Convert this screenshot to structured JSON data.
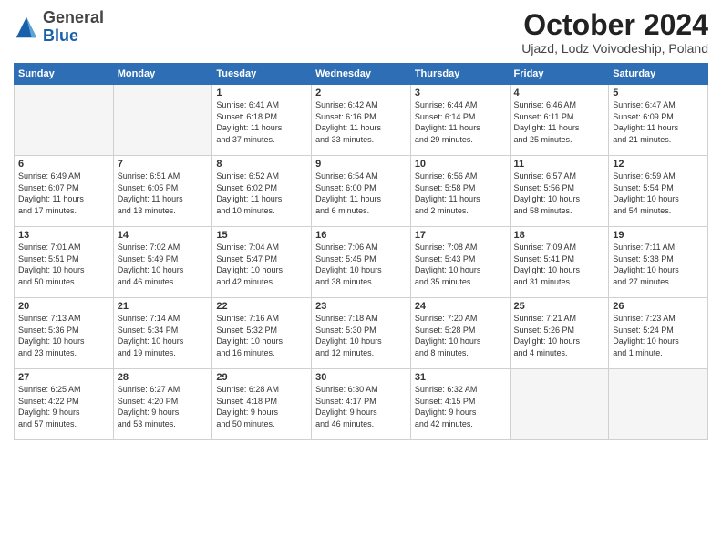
{
  "header": {
    "logo_line1": "General",
    "logo_line2": "Blue",
    "month_title": "October 2024",
    "subtitle": "Ujazd, Lodz Voivodeship, Poland"
  },
  "weekdays": [
    "Sunday",
    "Monday",
    "Tuesday",
    "Wednesday",
    "Thursday",
    "Friday",
    "Saturday"
  ],
  "weeks": [
    [
      {
        "day": "",
        "info": ""
      },
      {
        "day": "",
        "info": ""
      },
      {
        "day": "1",
        "info": "Sunrise: 6:41 AM\nSunset: 6:18 PM\nDaylight: 11 hours\nand 37 minutes."
      },
      {
        "day": "2",
        "info": "Sunrise: 6:42 AM\nSunset: 6:16 PM\nDaylight: 11 hours\nand 33 minutes."
      },
      {
        "day": "3",
        "info": "Sunrise: 6:44 AM\nSunset: 6:14 PM\nDaylight: 11 hours\nand 29 minutes."
      },
      {
        "day": "4",
        "info": "Sunrise: 6:46 AM\nSunset: 6:11 PM\nDaylight: 11 hours\nand 25 minutes."
      },
      {
        "day": "5",
        "info": "Sunrise: 6:47 AM\nSunset: 6:09 PM\nDaylight: 11 hours\nand 21 minutes."
      }
    ],
    [
      {
        "day": "6",
        "info": "Sunrise: 6:49 AM\nSunset: 6:07 PM\nDaylight: 11 hours\nand 17 minutes."
      },
      {
        "day": "7",
        "info": "Sunrise: 6:51 AM\nSunset: 6:05 PM\nDaylight: 11 hours\nand 13 minutes."
      },
      {
        "day": "8",
        "info": "Sunrise: 6:52 AM\nSunset: 6:02 PM\nDaylight: 11 hours\nand 10 minutes."
      },
      {
        "day": "9",
        "info": "Sunrise: 6:54 AM\nSunset: 6:00 PM\nDaylight: 11 hours\nand 6 minutes."
      },
      {
        "day": "10",
        "info": "Sunrise: 6:56 AM\nSunset: 5:58 PM\nDaylight: 11 hours\nand 2 minutes."
      },
      {
        "day": "11",
        "info": "Sunrise: 6:57 AM\nSunset: 5:56 PM\nDaylight: 10 hours\nand 58 minutes."
      },
      {
        "day": "12",
        "info": "Sunrise: 6:59 AM\nSunset: 5:54 PM\nDaylight: 10 hours\nand 54 minutes."
      }
    ],
    [
      {
        "day": "13",
        "info": "Sunrise: 7:01 AM\nSunset: 5:51 PM\nDaylight: 10 hours\nand 50 minutes."
      },
      {
        "day": "14",
        "info": "Sunrise: 7:02 AM\nSunset: 5:49 PM\nDaylight: 10 hours\nand 46 minutes."
      },
      {
        "day": "15",
        "info": "Sunrise: 7:04 AM\nSunset: 5:47 PM\nDaylight: 10 hours\nand 42 minutes."
      },
      {
        "day": "16",
        "info": "Sunrise: 7:06 AM\nSunset: 5:45 PM\nDaylight: 10 hours\nand 38 minutes."
      },
      {
        "day": "17",
        "info": "Sunrise: 7:08 AM\nSunset: 5:43 PM\nDaylight: 10 hours\nand 35 minutes."
      },
      {
        "day": "18",
        "info": "Sunrise: 7:09 AM\nSunset: 5:41 PM\nDaylight: 10 hours\nand 31 minutes."
      },
      {
        "day": "19",
        "info": "Sunrise: 7:11 AM\nSunset: 5:38 PM\nDaylight: 10 hours\nand 27 minutes."
      }
    ],
    [
      {
        "day": "20",
        "info": "Sunrise: 7:13 AM\nSunset: 5:36 PM\nDaylight: 10 hours\nand 23 minutes."
      },
      {
        "day": "21",
        "info": "Sunrise: 7:14 AM\nSunset: 5:34 PM\nDaylight: 10 hours\nand 19 minutes."
      },
      {
        "day": "22",
        "info": "Sunrise: 7:16 AM\nSunset: 5:32 PM\nDaylight: 10 hours\nand 16 minutes."
      },
      {
        "day": "23",
        "info": "Sunrise: 7:18 AM\nSunset: 5:30 PM\nDaylight: 10 hours\nand 12 minutes."
      },
      {
        "day": "24",
        "info": "Sunrise: 7:20 AM\nSunset: 5:28 PM\nDaylight: 10 hours\nand 8 minutes."
      },
      {
        "day": "25",
        "info": "Sunrise: 7:21 AM\nSunset: 5:26 PM\nDaylight: 10 hours\nand 4 minutes."
      },
      {
        "day": "26",
        "info": "Sunrise: 7:23 AM\nSunset: 5:24 PM\nDaylight: 10 hours\nand 1 minute."
      }
    ],
    [
      {
        "day": "27",
        "info": "Sunrise: 6:25 AM\nSunset: 4:22 PM\nDaylight: 9 hours\nand 57 minutes."
      },
      {
        "day": "28",
        "info": "Sunrise: 6:27 AM\nSunset: 4:20 PM\nDaylight: 9 hours\nand 53 minutes."
      },
      {
        "day": "29",
        "info": "Sunrise: 6:28 AM\nSunset: 4:18 PM\nDaylight: 9 hours\nand 50 minutes."
      },
      {
        "day": "30",
        "info": "Sunrise: 6:30 AM\nSunset: 4:17 PM\nDaylight: 9 hours\nand 46 minutes."
      },
      {
        "day": "31",
        "info": "Sunrise: 6:32 AM\nSunset: 4:15 PM\nDaylight: 9 hours\nand 42 minutes."
      },
      {
        "day": "",
        "info": ""
      },
      {
        "day": "",
        "info": ""
      }
    ]
  ]
}
